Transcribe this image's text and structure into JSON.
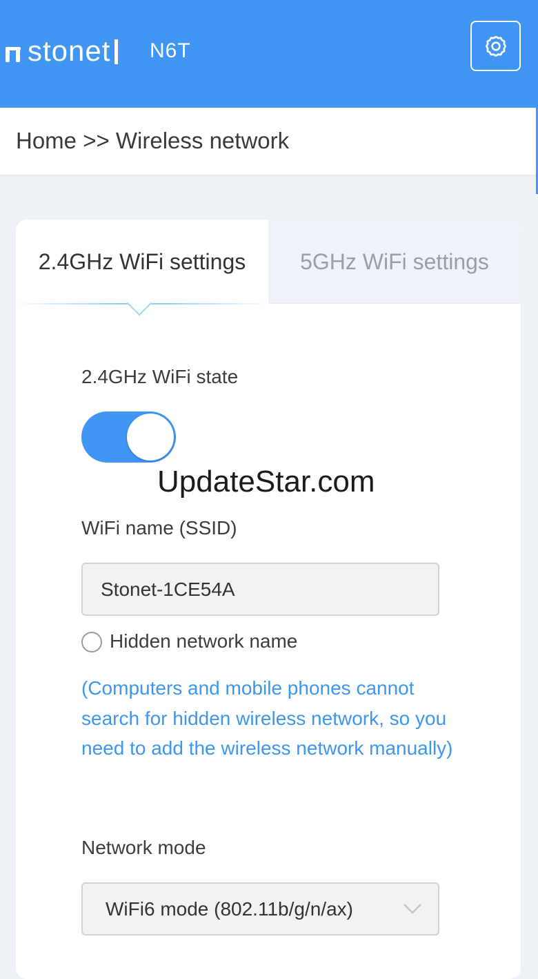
{
  "header": {
    "brand": "stonet",
    "model": "N6T",
    "settings_icon": "gear-icon",
    "background_color": "#4196f4"
  },
  "breadcrumb": {
    "text": "Home >> Wireless network"
  },
  "tabs": [
    {
      "label": "2.4GHz WiFi settings",
      "active": true
    },
    {
      "label": "5GHz WiFi settings",
      "active": false
    }
  ],
  "form": {
    "wifi_state_label": "2.4GHz WiFi state",
    "wifi_state_on": true,
    "ssid_label": "WiFi name (SSID)",
    "ssid_value": "Stonet-1CE54A",
    "hidden_label": "Hidden network name",
    "hidden_checked": false,
    "hidden_hint": "(Computers and mobile phones cannot search for hidden wireless network, so you need to add the wireless network manually)",
    "mode_label": "Network mode",
    "mode_value": "WiFi6 mode (802.11b/g/n/ax)",
    "accent_color": "#3d96ef"
  },
  "watermark": "UpdateStar.com"
}
